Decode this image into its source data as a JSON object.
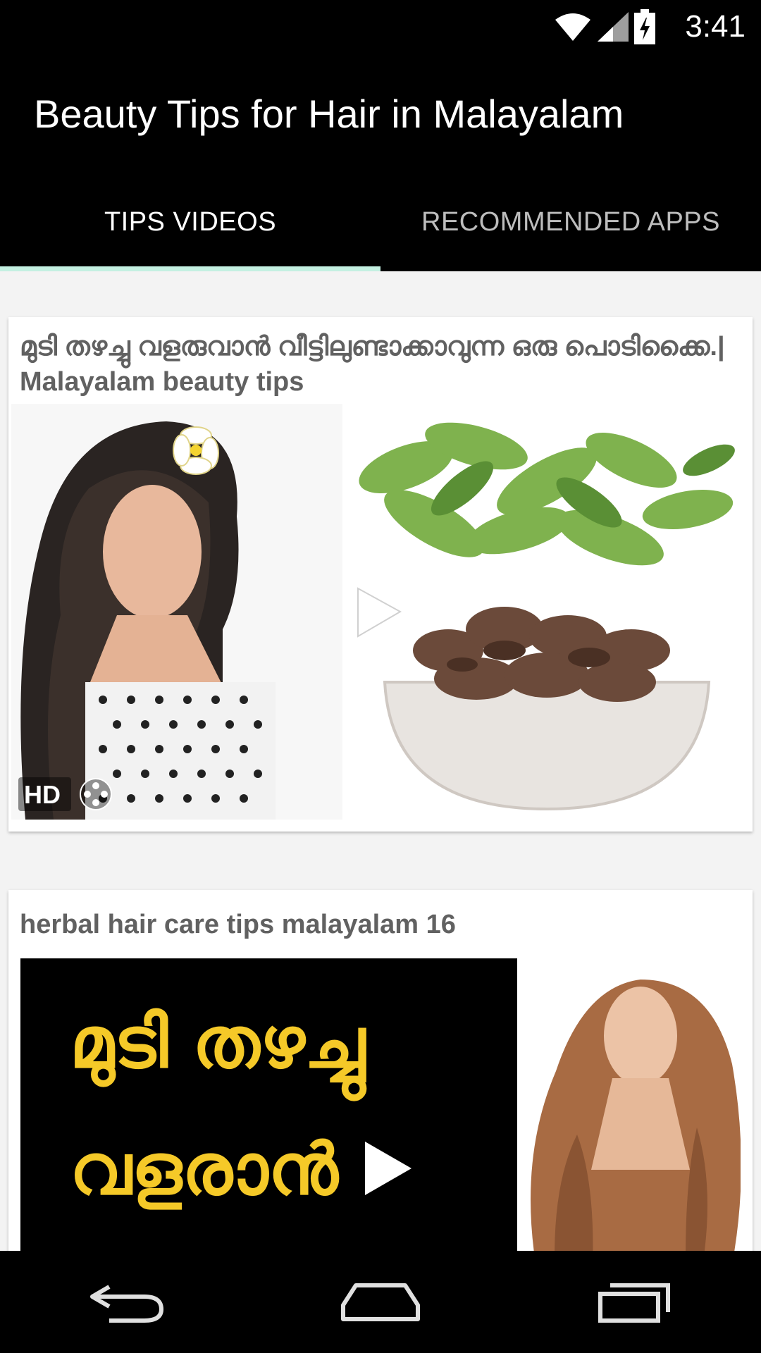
{
  "status": {
    "time": "3:41"
  },
  "app": {
    "title": "Beauty Tips for Hair in Malayalam"
  },
  "tabs": [
    {
      "label": "TIPS VIDEOS",
      "active": true
    },
    {
      "label": "RECOMMENDED APPS",
      "active": false
    }
  ],
  "videos": [
    {
      "title": "മുടി തഴച്ചു വളരുവാൻ വീട്ടിലുണ്ടാക്കാവുന്ന ഒരു പൊടിക്കൈ.| Malayalam beauty tips",
      "badge": "HD"
    },
    {
      "title": "herbal hair care tips malayalam 16",
      "overlay_line1": "മുടി തഴച്ചു",
      "overlay_line2": "വളരാൻ"
    }
  ],
  "colors": {
    "bar": "#000000",
    "tab_indicator": "#c4f0e2",
    "card_title": "#616161",
    "overlay_text": "#f5c928"
  }
}
